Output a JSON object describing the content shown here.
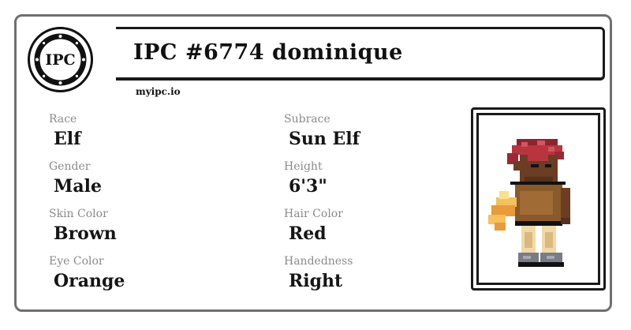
{
  "logo": {
    "text": "IPC",
    "icon": "ipc-seal-icon"
  },
  "header": {
    "title": "IPC #6774 dominique",
    "site": "myipc.io"
  },
  "fields": {
    "race": {
      "label": "Race",
      "value": "Elf"
    },
    "subrace": {
      "label": "Subrace",
      "value": "Sun Elf"
    },
    "gender": {
      "label": "Gender",
      "value": "Male"
    },
    "height": {
      "label": "Height",
      "value": "6'3\""
    },
    "skin_color": {
      "label": "Skin Color",
      "value": "Brown"
    },
    "hair_color": {
      "label": "Hair Color",
      "value": "Red"
    },
    "eye_color": {
      "label": "Eye Color",
      "value": "Orange"
    },
    "handedness": {
      "label": "Handedness",
      "value": "Right"
    }
  },
  "portrait": {
    "icon": "character-sprite-icon"
  },
  "colors": {
    "card_border": "#6f6f6f",
    "ink": "#151515",
    "label": "#8a8a8a",
    "hair": "#b8343f",
    "skin": "#6b3d22",
    "tunic": "#8a5a2b",
    "flame": "#f4c15a"
  }
}
